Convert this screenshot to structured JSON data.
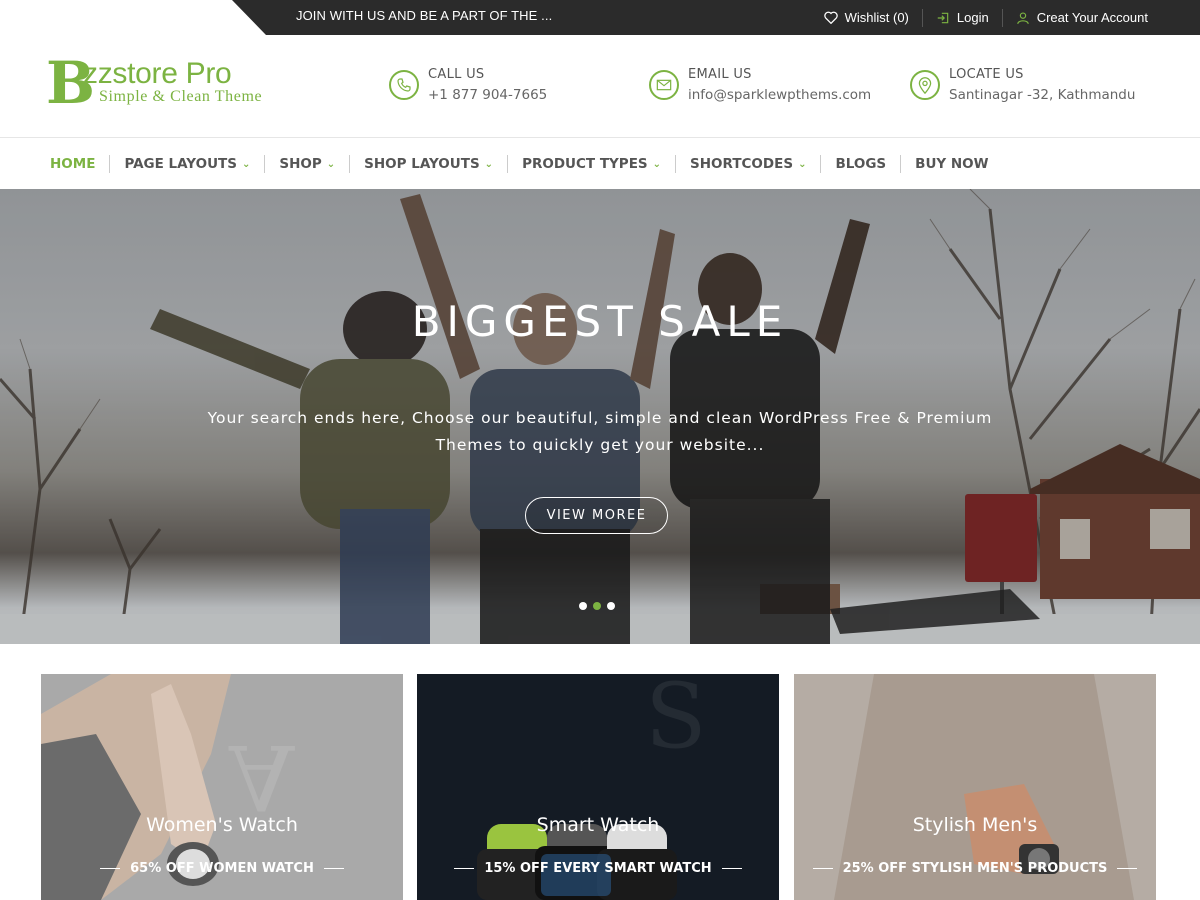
{
  "topbar": {
    "marquee": "JOIN WITH US AND BE A PART OF THE ...",
    "wishlist_label": "Wishlist",
    "wishlist_count": "(0)",
    "login_label": "Login",
    "account_label": "Creat Your Account"
  },
  "logo": {
    "initial": "B",
    "name": "zzstore Pro",
    "tagline": "Simple & Clean Theme"
  },
  "contacts": [
    {
      "label": "CALL US",
      "value": "+1 877 904-7665",
      "icon": "phone-icon"
    },
    {
      "label": "EMAIL US",
      "value": "info@sparklewpthems.com",
      "icon": "mail-icon"
    },
    {
      "label": "LOCATE US",
      "value": "Santinagar -32, Kathmandu",
      "icon": "location-pin-icon"
    }
  ],
  "nav": {
    "items": [
      {
        "label": "HOME",
        "active": true,
        "dropdown": false
      },
      {
        "label": "PAGE LAYOUTS",
        "dropdown": true
      },
      {
        "label": "SHOP",
        "dropdown": true
      },
      {
        "label": "SHOP LAYOUTS",
        "dropdown": true
      },
      {
        "label": "PRODUCT TYPES",
        "dropdown": true
      },
      {
        "label": "SHORTCODES",
        "dropdown": true
      },
      {
        "label": "BLOGS",
        "dropdown": false
      },
      {
        "label": "BUY NOW",
        "dropdown": false
      }
    ]
  },
  "hero": {
    "title": "BIGGEST SALE",
    "subtitle": "Your search ends here, Choose our beautiful, simple and clean WordPress Free & Premium Themes to quickly get your website...",
    "button_label": "VIEW MOREE",
    "slide_count": 3,
    "active_slide": 2
  },
  "categories": [
    {
      "title": "Women's Watch",
      "offer": "65% OFF WOMEN WATCH"
    },
    {
      "title": "Smart Watch",
      "offer": "15% OFF EVERY SMART WATCH"
    },
    {
      "title": "Stylish Men's",
      "offer": "25% OFF STYLISH MEN'S PRODUCTS"
    }
  ],
  "colors": {
    "accent": "#7cb342",
    "topbar": "#2b2b2b",
    "text": "#555555"
  }
}
